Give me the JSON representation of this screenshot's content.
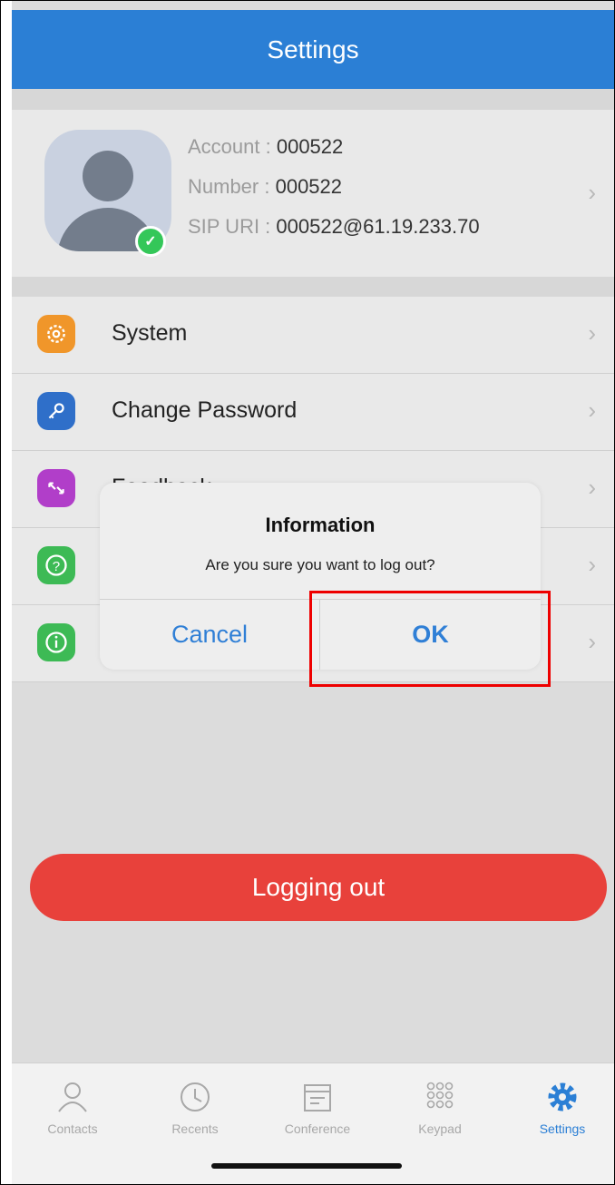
{
  "header": {
    "title": "Settings"
  },
  "profile": {
    "account_label": "Account : ",
    "account_value": "000522",
    "number_label": "Number : ",
    "number_value": "000522",
    "sip_label": "SIP URI : ",
    "sip_value": "000522@61.19.233.70"
  },
  "menu": {
    "items": [
      {
        "label": "System",
        "icon": "gear-icon",
        "color": "#f0962a"
      },
      {
        "label": "Change Password",
        "icon": "key-icon",
        "color": "#2f6fc9"
      },
      {
        "label": "Feedback",
        "icon": "expand-arrows-icon",
        "color": "#b13ec9"
      },
      {
        "label": "",
        "icon": "help-icon",
        "color": "#3dba55"
      },
      {
        "label": "",
        "icon": "info-icon",
        "color": "#3dba55"
      }
    ]
  },
  "dialog": {
    "title": "Information",
    "message": "Are you sure you want to log out?",
    "cancel_label": "Cancel",
    "ok_label": "OK"
  },
  "logout": {
    "label": "Logging out"
  },
  "tabs": [
    {
      "label": "Contacts",
      "icon": "person-icon"
    },
    {
      "label": "Recents",
      "icon": "clock-icon"
    },
    {
      "label": "Conference",
      "icon": "calendar-icon"
    },
    {
      "label": "Keypad",
      "icon": "keypad-icon"
    },
    {
      "label": "Settings",
      "icon": "gear-icon",
      "active": true
    }
  ],
  "colors": {
    "accent": "#2b7fd5",
    "logout": "#e8413b",
    "highlight": "#e00000"
  }
}
